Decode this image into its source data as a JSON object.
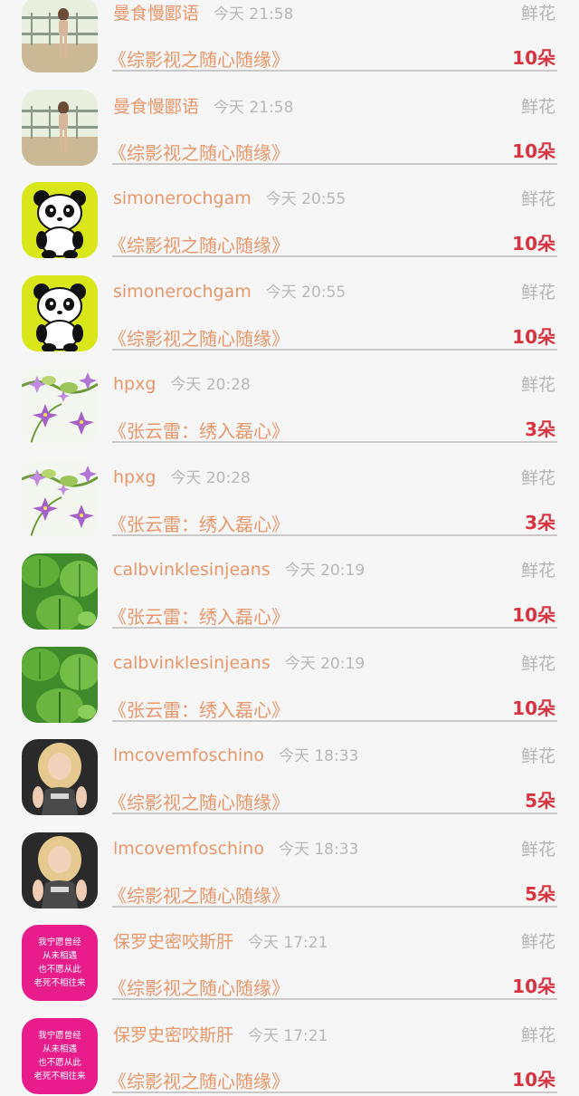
{
  "items": [
    {
      "name": "曼食慢郾语",
      "time": "今天 21:58",
      "gift": "鲜花",
      "book": "《综影视之随心随缘》",
      "count": "10朵",
      "avatar": "photo-girl-fence-icon"
    },
    {
      "name": "曼食慢郾语",
      "time": "今天 21:58",
      "gift": "鲜花",
      "book": "《综影视之随心随缘》",
      "count": "10朵",
      "avatar": "photo-girl-fence-icon"
    },
    {
      "name": "simonerochgam",
      "time": "今天 20:55",
      "gift": "鲜花",
      "book": "《综影视之随心随缘》",
      "count": "10朵",
      "avatar": "panda-icon"
    },
    {
      "name": "simonerochgam",
      "time": "今天 20:55",
      "gift": "鲜花",
      "book": "《综影视之随心随缘》",
      "count": "10朵",
      "avatar": "panda-icon"
    },
    {
      "name": "hpxg",
      "time": "今天 20:28",
      "gift": "鲜花",
      "book": "《张云雷：绣入磊心》",
      "count": "3朵",
      "avatar": "purple-flowers-icon"
    },
    {
      "name": "hpxg",
      "time": "今天 20:28",
      "gift": "鲜花",
      "book": "《张云雷：绣入磊心》",
      "count": "3朵",
      "avatar": "purple-flowers-icon"
    },
    {
      "name": "calbvinklesinjeans",
      "time": "今天 20:19",
      "gift": "鲜花",
      "book": "《张云雷：绣入磊心》",
      "count": "10朵",
      "avatar": "green-leaves-icon"
    },
    {
      "name": "calbvinklesinjeans",
      "time": "今天 20:19",
      "gift": "鲜花",
      "book": "《张云雷：绣入磊心》",
      "count": "10朵",
      "avatar": "green-leaves-icon"
    },
    {
      "name": "lmcovemfoschino",
      "time": "今天 18:33",
      "gift": "鲜花",
      "book": "《综影视之随心随缘》",
      "count": "5朵",
      "avatar": "photo-blonde-woman-icon"
    },
    {
      "name": "lmcovemfoschino",
      "time": "今天 18:33",
      "gift": "鲜花",
      "book": "《综影视之随心随缘》",
      "count": "5朵",
      "avatar": "photo-blonde-woman-icon"
    },
    {
      "name": "保罗史密咬斯肝",
      "time": "今天 17:21",
      "gift": "鲜花",
      "book": "《综影视之随心随缘》",
      "count": "10朵",
      "avatar": "pink-quote-icon",
      "avatar_text": [
        "我宁愿曾经",
        "从未相遇",
        "也不愿从此",
        "老死不相往来"
      ]
    },
    {
      "name": "保罗史密咬斯肝",
      "time": "今天 17:21",
      "gift": "鲜花",
      "book": "《综影视之随心随缘》",
      "count": "10朵",
      "avatar": "pink-quote-icon",
      "avatar_text": [
        "我宁愿曾经",
        "从未相遇",
        "也不愿从此",
        "老死不相往来"
      ]
    }
  ],
  "colors": {
    "name": "#e8966a",
    "time": "#b8b8b8",
    "gift": "#b4b4b4",
    "count": "#d9333f",
    "background": "#f6f6f6"
  }
}
